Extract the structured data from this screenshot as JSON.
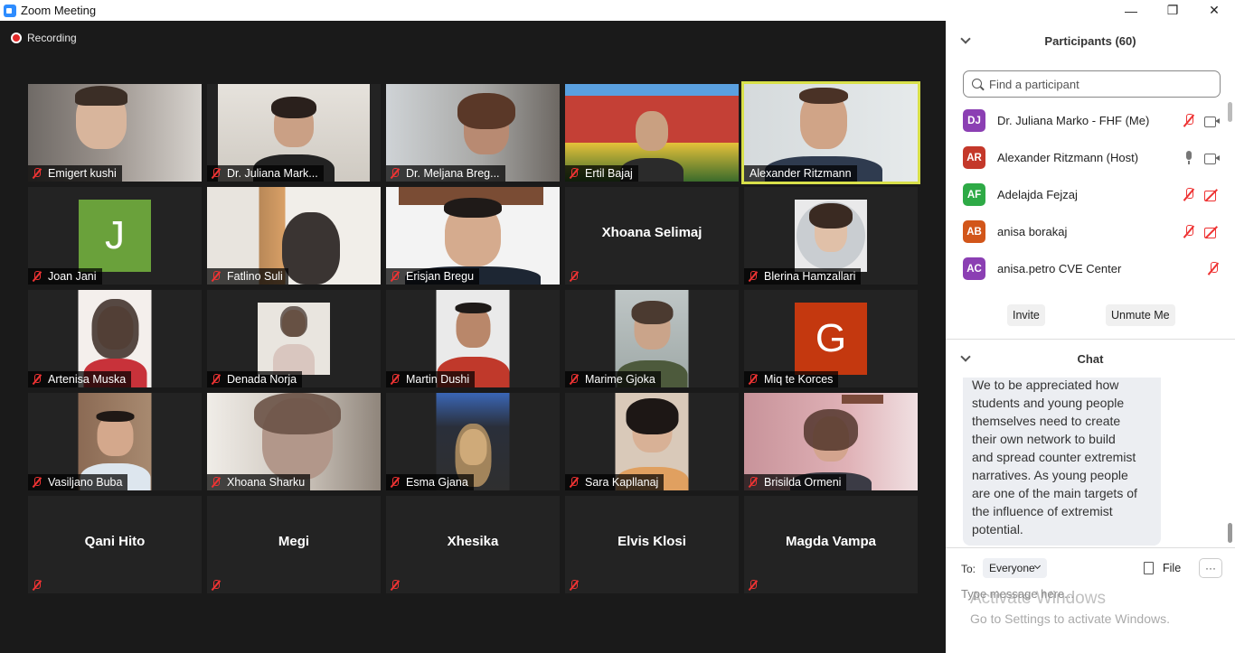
{
  "window": {
    "title": "Zoom Meeting",
    "minimize": "—",
    "restore": "❐",
    "close": "✕"
  },
  "meeting": {
    "recording_label": "Recording",
    "tiles": [
      {
        "name": "Emigert kushi",
        "type": "video"
      },
      {
        "name": "Dr. Juliana Mark...",
        "type": "video"
      },
      {
        "name": "Dr. Meljana Breg...",
        "type": "video"
      },
      {
        "name": "Ertil Bajaj",
        "type": "video"
      },
      {
        "name": "Alexander Ritzmann",
        "type": "video",
        "active": true
      },
      {
        "name": "Joan Jani",
        "type": "avatar",
        "initial": "J",
        "color": "#6aa13b"
      },
      {
        "name": "Fatlino Suli",
        "type": "video"
      },
      {
        "name": "Erisjan Bregu",
        "type": "video"
      },
      {
        "name": "Xhoana Selimaj",
        "type": "name"
      },
      {
        "name": "Blerina Hamzallari",
        "type": "photo"
      },
      {
        "name": "Artenisa Muska",
        "type": "video"
      },
      {
        "name": "Denada Norja",
        "type": "video"
      },
      {
        "name": "Martin Dushi",
        "type": "video"
      },
      {
        "name": "Marime Gjoka",
        "type": "video"
      },
      {
        "name": "Miq te Korces",
        "type": "avatar",
        "initial": "G",
        "color": "#c4380f"
      },
      {
        "name": "Vasiljano Buba",
        "type": "video"
      },
      {
        "name": "Xhoana Sharku",
        "type": "video"
      },
      {
        "name": "Esma Gjana",
        "type": "video"
      },
      {
        "name": "Sara Kapllanaj",
        "type": "video"
      },
      {
        "name": "Brisilda Ormeni",
        "type": "video"
      },
      {
        "name": "Qani Hito",
        "type": "name"
      },
      {
        "name": "Megi",
        "type": "name"
      },
      {
        "name": "Xhesika",
        "type": "name"
      },
      {
        "name": "Elvis Klosi",
        "type": "name"
      },
      {
        "name": "Magda Vampa",
        "type": "name"
      }
    ]
  },
  "participants": {
    "header": "Participants (60)",
    "search_placeholder": "Find a participant",
    "list": [
      {
        "initials": "DJ",
        "color": "#8b3fb3",
        "name": "Dr. Juliana Marko - FHF (Me)",
        "mic": "off",
        "cam": "on"
      },
      {
        "initials": "AR",
        "color": "#c4382a",
        "name": "Alexander Ritzmann (Host)",
        "mic": "on",
        "cam": "on"
      },
      {
        "initials": "AF",
        "color": "#2eaa46",
        "name": "Adelajda Fejzaj",
        "mic": "off",
        "cam": "off"
      },
      {
        "initials": "AB",
        "color": "#d2561a",
        "name": "anisa borakaj",
        "mic": "off",
        "cam": "off"
      },
      {
        "initials": "AC",
        "color": "#8b3fb3",
        "name": "anisa.petro CVE Center",
        "mic": "off",
        "cam": "none"
      }
    ],
    "invite_label": "Invite",
    "unmute_label": "Unmute Me"
  },
  "chat": {
    "header": "Chat",
    "message_partial_top": "We to be appreciated how",
    "message_lines": [
      "students and young people",
      "themselves need to create",
      "their own network to build",
      "and spread counter extremist",
      "narratives. As young people",
      "are one of the main targets of",
      "the influence of extremist",
      "potential."
    ],
    "to_label": "To:",
    "to_value": "Everyone",
    "file_label": "File",
    "more_label": "···",
    "input_placeholder": "Type message here...",
    "watermark_title": "Activate Windows",
    "watermark_sub": "Go to Settings to activate Windows."
  }
}
